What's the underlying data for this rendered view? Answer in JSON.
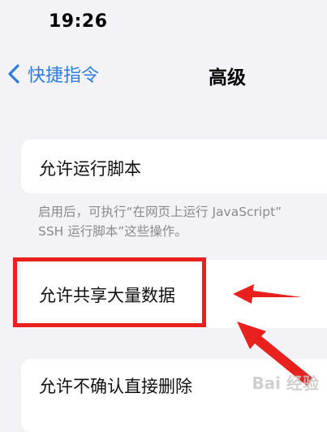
{
  "status_bar": {
    "time": "19:26"
  },
  "nav": {
    "back_label": "快捷指令",
    "title": "高级"
  },
  "settings": {
    "row1": {
      "label": "允许运行脚本"
    },
    "row1_footnote": [
      "启用后，可执行“在网页上运行 JavaScript”",
      "SSH 运行脚本”这些操作。"
    ],
    "row2": {
      "label": "允许共享大量数据"
    },
    "row3": {
      "label": "允许不确认直接删除"
    }
  },
  "annotations": {
    "highlight_color": "#e8201e",
    "watermark": "Bai 经验"
  }
}
